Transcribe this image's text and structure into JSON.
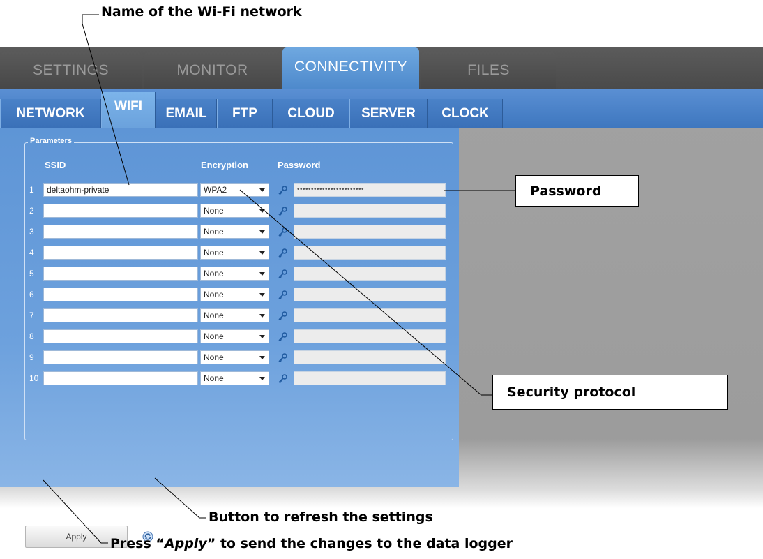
{
  "main_tabs": [
    {
      "label": "SETTINGS",
      "active": false
    },
    {
      "label": "MONITOR",
      "active": false
    },
    {
      "label": "CONNECTIVITY",
      "active": true
    },
    {
      "label": "FILES",
      "active": false
    }
  ],
  "sub_tabs": [
    {
      "label": "NETWORK",
      "active": false
    },
    {
      "label": "WIFI",
      "active": true
    },
    {
      "label": "EMAIL",
      "active": false
    },
    {
      "label": "FTP",
      "active": false
    },
    {
      "label": "CLOUD",
      "active": false
    },
    {
      "label": "SERVER",
      "active": false
    },
    {
      "label": "CLOCK",
      "active": false
    }
  ],
  "panel": {
    "legend": "Parameters",
    "columns": {
      "ssid": "SSID",
      "encryption": "Encryption",
      "password": "Password"
    },
    "rows": [
      {
        "num": "1",
        "ssid": "deltaohm-private",
        "encryption": "WPA2",
        "password": "••••••••••••••••••••••••"
      },
      {
        "num": "2",
        "ssid": "",
        "encryption": "None",
        "password": ""
      },
      {
        "num": "3",
        "ssid": "",
        "encryption": "None",
        "password": ""
      },
      {
        "num": "4",
        "ssid": "",
        "encryption": "None",
        "password": ""
      },
      {
        "num": "5",
        "ssid": "",
        "encryption": "None",
        "password": ""
      },
      {
        "num": "6",
        "ssid": "",
        "encryption": "None",
        "password": ""
      },
      {
        "num": "7",
        "ssid": "",
        "encryption": "None",
        "password": ""
      },
      {
        "num": "8",
        "ssid": "",
        "encryption": "None",
        "password": ""
      },
      {
        "num": "9",
        "ssid": "",
        "encryption": "None",
        "password": ""
      },
      {
        "num": "10",
        "ssid": "",
        "encryption": "None",
        "password": ""
      }
    ],
    "apply_label": "Apply"
  },
  "annotations": {
    "ssid_note": "Name of the Wi-Fi network",
    "password_note": "Password",
    "security_note": "Security protocol",
    "refresh_note": "Button to refresh the settings",
    "apply_note_prefix": "Press “",
    "apply_note_em": "Apply",
    "apply_note_suffix": "” to send the changes to the data logger"
  },
  "icons": {
    "key": "key-icon",
    "refresh": "refresh-icon",
    "dropdown": "chevron-down-icon"
  },
  "colors": {
    "accent": "#4c88cb",
    "tab_dark": "#4a4a4a",
    "panel": "#5e95d6"
  }
}
